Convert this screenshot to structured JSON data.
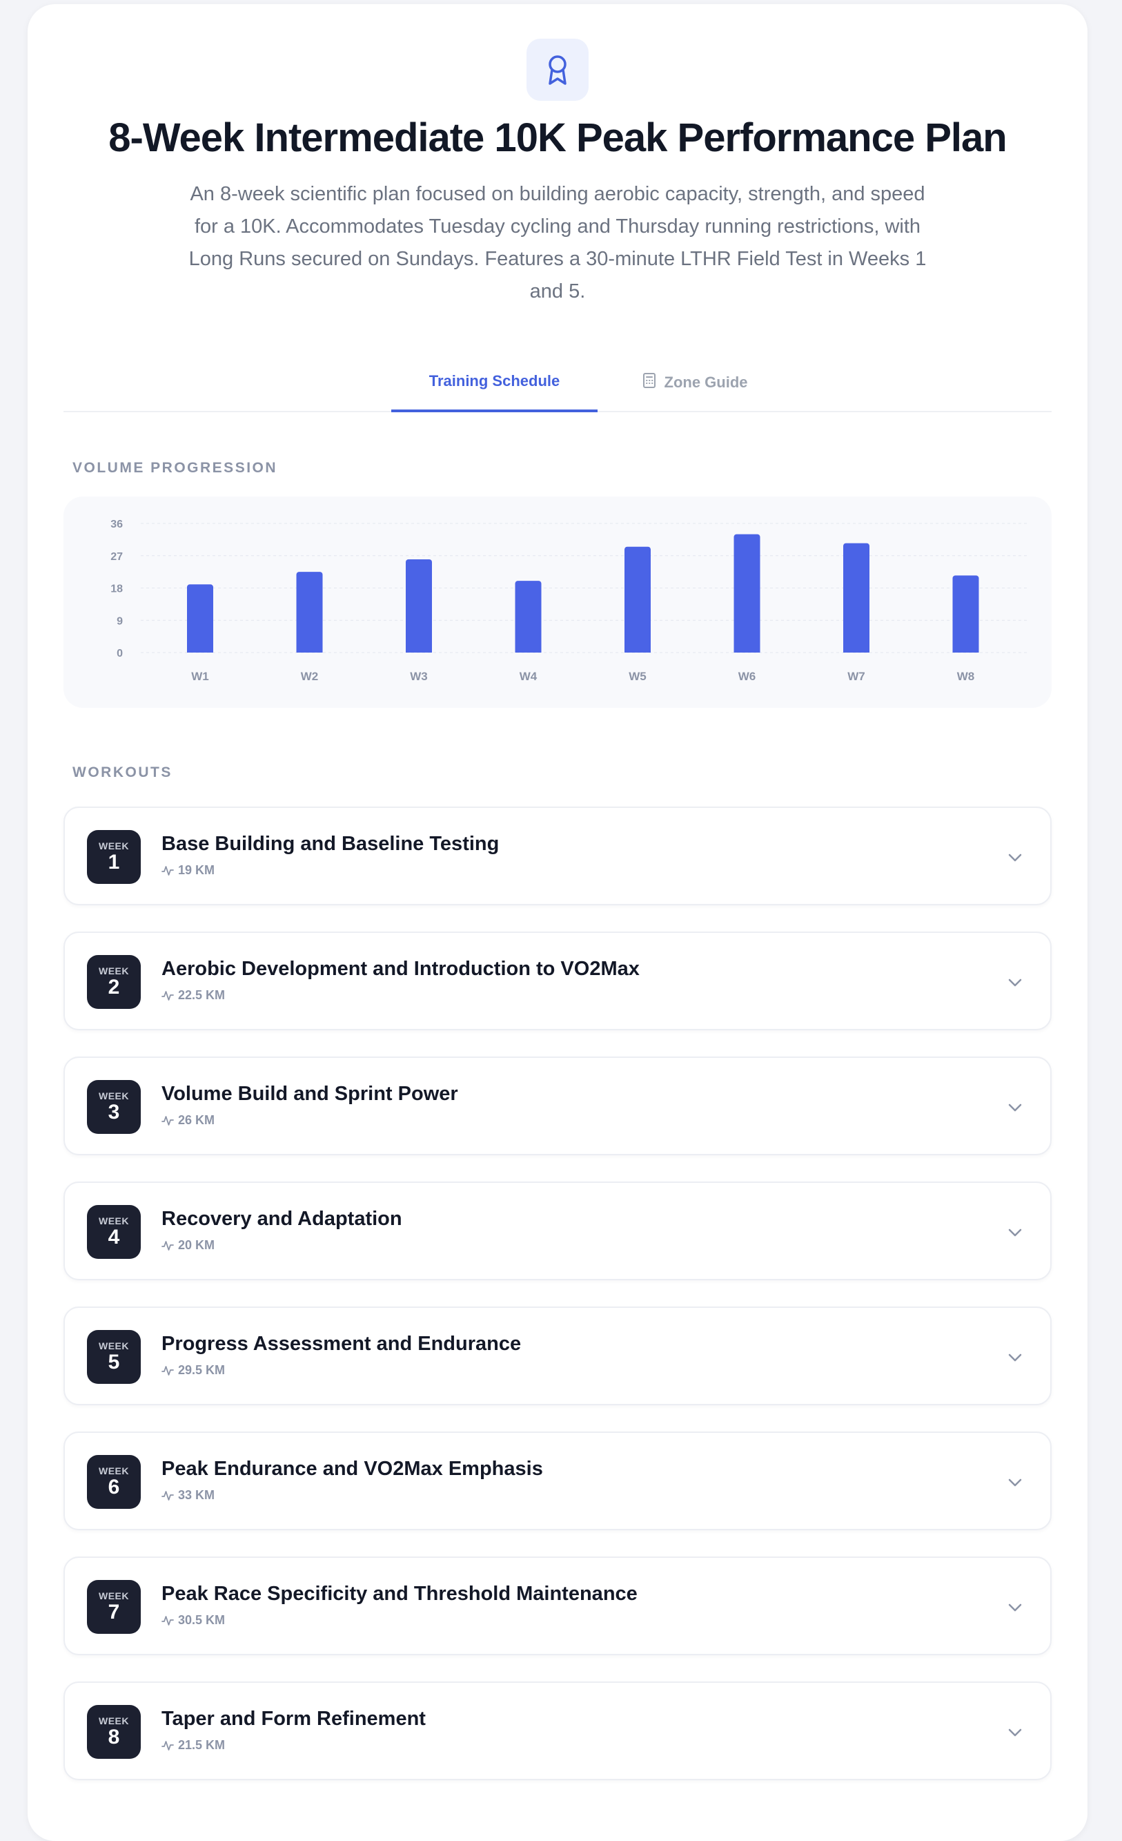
{
  "header": {
    "title": "8-Week Intermediate 10K Peak Performance Plan",
    "description": "An 8-week scientific plan focused on building aerobic capacity, strength, and speed for a 10K. Accommodates Tuesday cycling and Thursday running restrictions, with Long Runs secured on Sundays. Features a 30-minute LTHR Field Test in Weeks 1 and 5.",
    "icon": "award-ribbon-icon"
  },
  "tabs": [
    {
      "label": "Training Schedule",
      "active": true
    },
    {
      "label": "Zone Guide",
      "active": false,
      "icon": "calculator-icon"
    }
  ],
  "sections": {
    "volume_label": "VOLUME PROGRESSION",
    "workouts_label": "WORKOUTS"
  },
  "chart_data": {
    "type": "bar",
    "categories": [
      "W1",
      "W2",
      "W3",
      "W4",
      "W5",
      "W6",
      "W7",
      "W8"
    ],
    "values": [
      19,
      22.5,
      26,
      20,
      29.5,
      33,
      30.5,
      21.5
    ],
    "yticks": [
      "0",
      "9",
      "18",
      "27",
      "36"
    ],
    "ylim": [
      0,
      36
    ],
    "grid": true,
    "bar_color": "#4a63e6"
  },
  "weeks": [
    {
      "label": "WEEK",
      "number": "1",
      "title": "Base Building and Baseline Testing",
      "km": "19 KM"
    },
    {
      "label": "WEEK",
      "number": "2",
      "title": "Aerobic Development and Introduction to VO2Max",
      "km": "22.5 KM"
    },
    {
      "label": "WEEK",
      "number": "3",
      "title": "Volume Build and Sprint Power",
      "km": "26 KM"
    },
    {
      "label": "WEEK",
      "number": "4",
      "title": "Recovery and Adaptation",
      "km": "20 KM"
    },
    {
      "label": "WEEK",
      "number": "5",
      "title": "Progress Assessment and Endurance",
      "km": "29.5 KM"
    },
    {
      "label": "WEEK",
      "number": "6",
      "title": "Peak Endurance and VO2Max Emphasis",
      "km": "33 KM"
    },
    {
      "label": "WEEK",
      "number": "7",
      "title": "Peak Race Specificity and Threshold Maintenance",
      "km": "30.5 KM"
    },
    {
      "label": "WEEK",
      "number": "8",
      "title": "Taper and Form Refinement",
      "km": "21.5 KM"
    }
  ],
  "colors": {
    "accent": "#4361dd",
    "badge_bg": "#1c2030",
    "muted": "#8b93a6"
  }
}
